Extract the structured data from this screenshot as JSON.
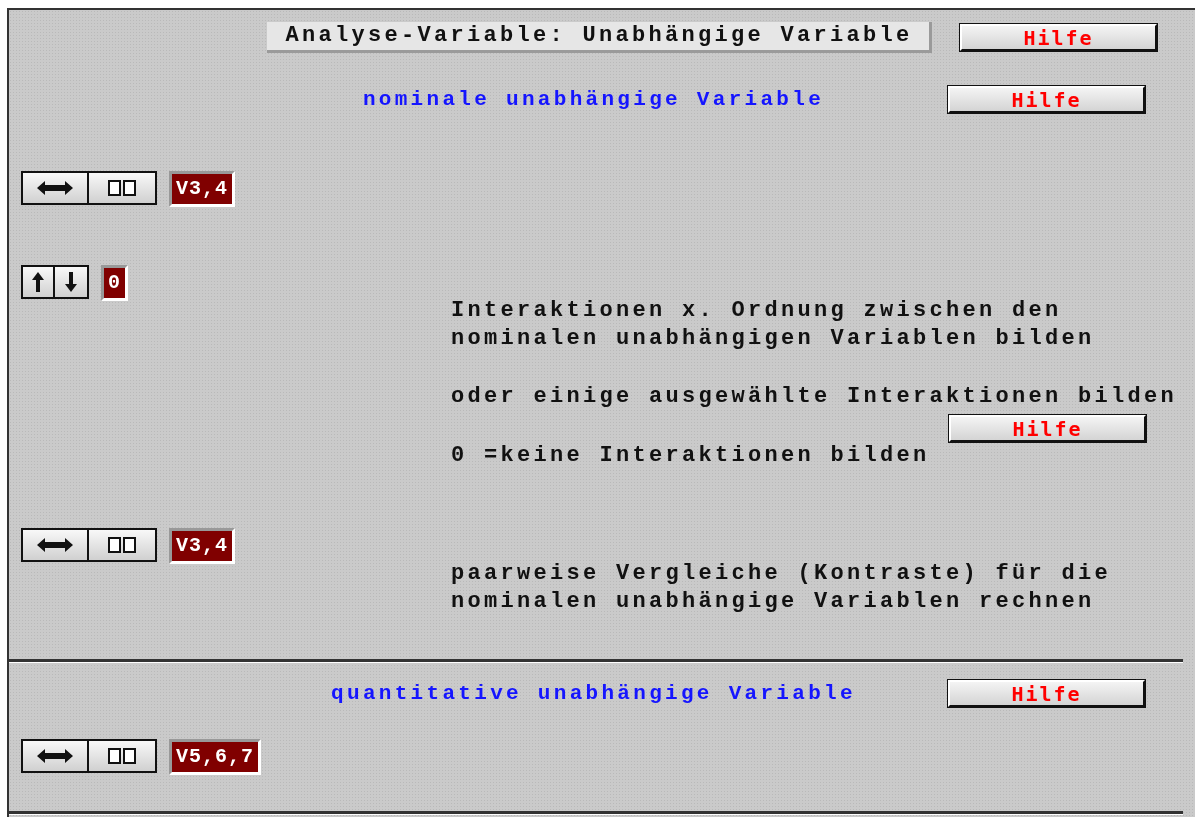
{
  "header": {
    "title": "Analyse-Variable: Unabhängige Variable",
    "help": "Hilfe"
  },
  "sections": [
    {
      "heading": "nominale unabhängige Variable",
      "help": "Hilfe",
      "items": [
        {
          "kind": "variables",
          "value": "V3,4"
        },
        {
          "kind": "order",
          "value": "0",
          "description": "Interaktionen x. Ordnung zwischen den\nnominalen unabhängigen Variablen bilden",
          "alternative": "oder einige ausgewählte Interaktionen bilden",
          "help": "Hilfe",
          "note": "0 =keine Interaktionen bilden"
        },
        {
          "kind": "variables",
          "value": "V3,4",
          "description": "paarweise Vergleiche (Kontraste) für die\nnominalen unabhängige Variablen rechnen"
        }
      ]
    },
    {
      "heading": "quantitative unabhängige Variable",
      "help": "Hilfe",
      "items": [
        {
          "kind": "variables",
          "value": "V5,6,7"
        }
      ]
    }
  ]
}
